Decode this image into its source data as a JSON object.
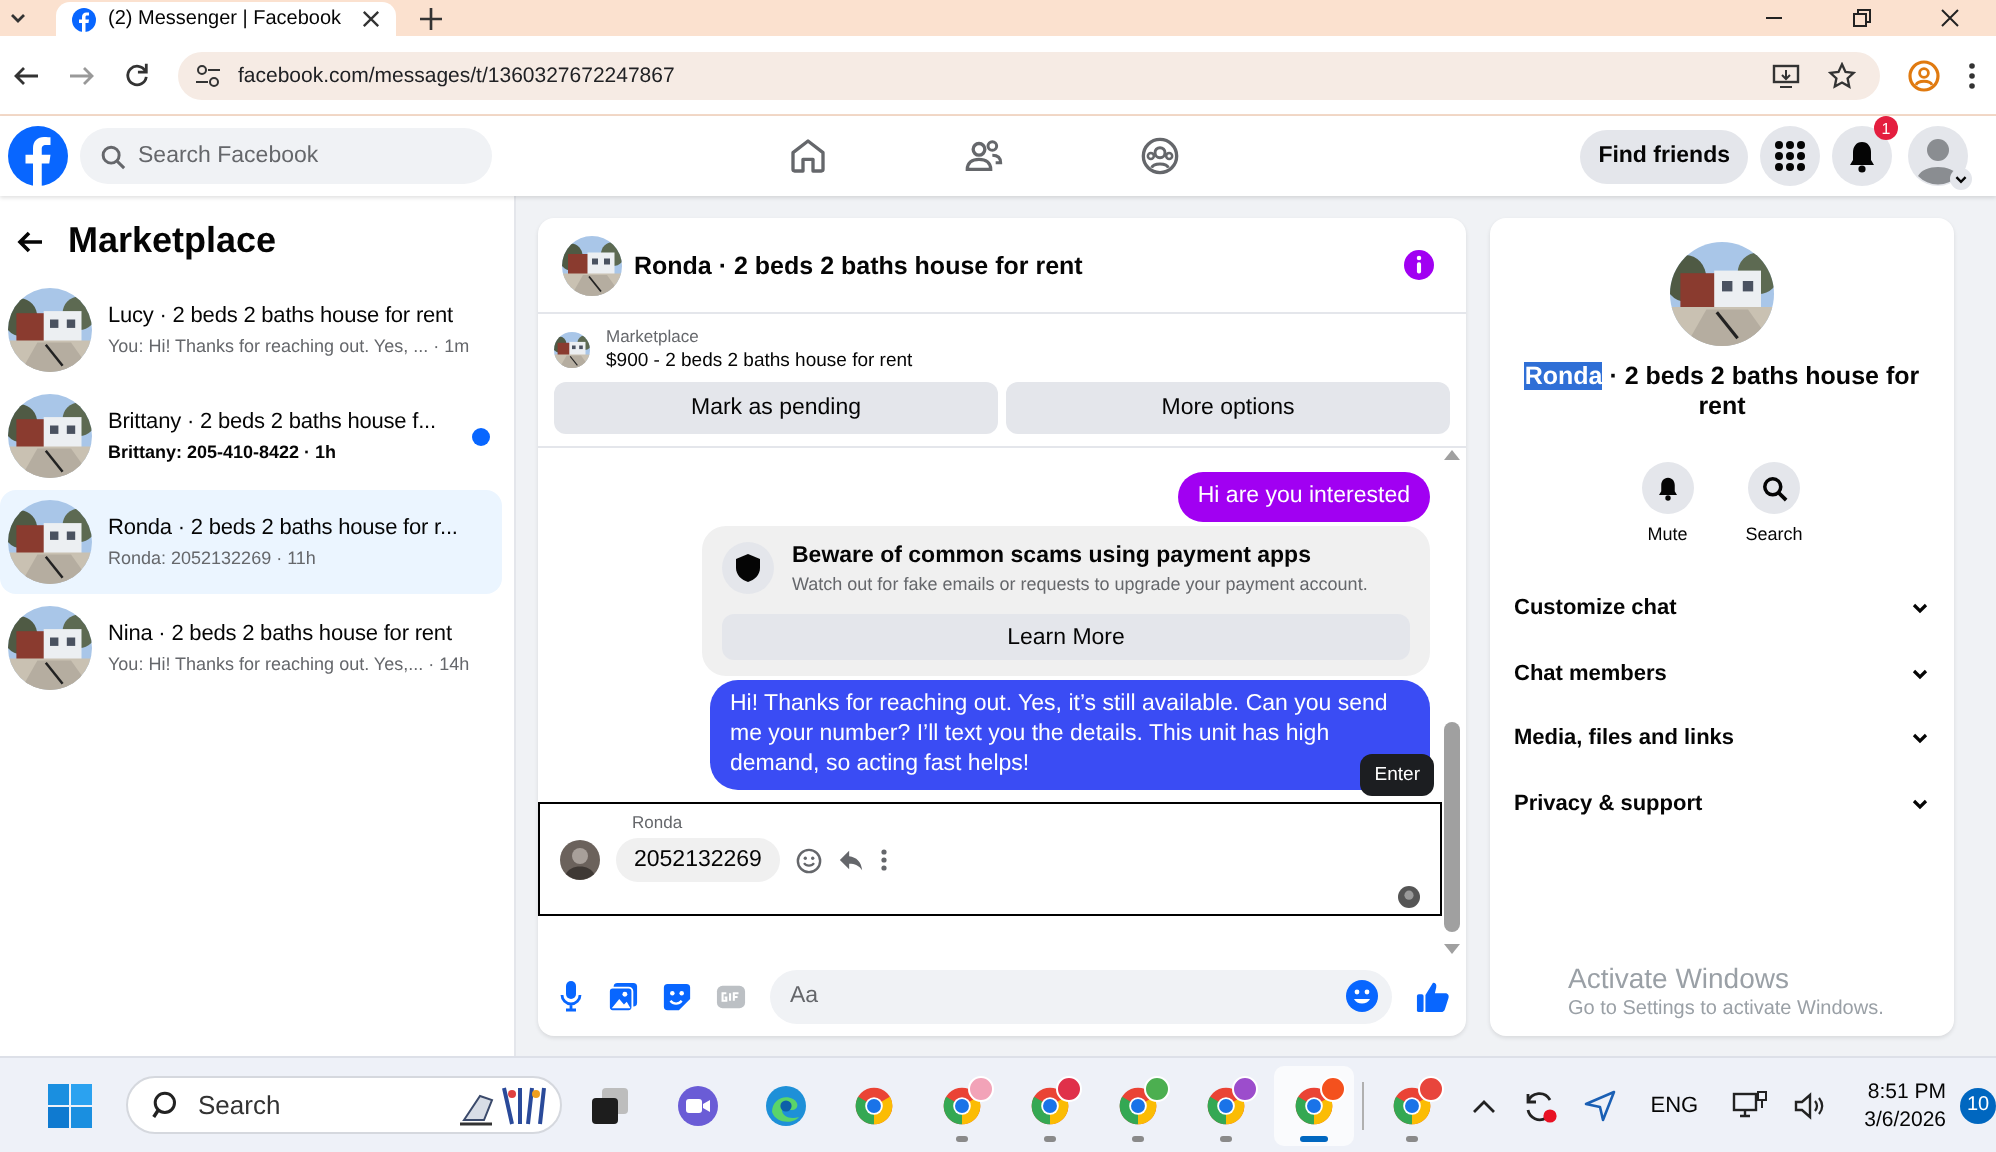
{
  "browser": {
    "tab": {
      "title": "(2) Messenger | Facebook"
    },
    "url": "facebook.com/messages/t/1360327672247867"
  },
  "header": {
    "search": {
      "placeholder": "Search Facebook"
    },
    "nav": [
      {
        "kind": "home"
      },
      {
        "kind": "friends"
      },
      {
        "kind": "groups"
      }
    ],
    "find_friends": "Find friends",
    "notifications_badge": "1"
  },
  "sidebar": {
    "title": "Marketplace",
    "items": [
      {
        "title": "Lucy · 2 beds 2 baths house for rent",
        "preview": "You: Hi! Thanks for reaching out. Yes, ... · 1m",
        "unread": false,
        "selected": false
      },
      {
        "title": "Brittany · 2 beds 2 baths house f...",
        "preview": "Brittany: 205-410-8422 · 1h",
        "unread": true,
        "selected": false
      },
      {
        "title": "Ronda · 2 beds 2 baths house for r...",
        "preview": "Ronda: 2052132269 · 11h",
        "unread": false,
        "selected": true
      },
      {
        "title": "Nina · 2 beds 2 baths house for rent",
        "preview": "You: Hi! Thanks for reaching out. Yes,... · 14h",
        "unread": false,
        "selected": false
      }
    ]
  },
  "chat": {
    "title": "Ronda · 2 beds 2 baths house for rent",
    "listing": {
      "label": "Marketplace",
      "title": "$900 - 2 beds 2 baths house for rent"
    },
    "actions": [
      "Mark as pending",
      "More options"
    ],
    "messages": [
      {
        "kind": "outgoing",
        "text": "Hi are you interested",
        "color": "#a100f2"
      },
      {
        "kind": "notice",
        "title": "Beware of common scams using payment apps",
        "text": "Watch out for fake emails or requests to upgrade your payment account.",
        "button": "Learn More"
      },
      {
        "kind": "outgoing",
        "text": "Hi! Thanks for reaching out. Yes, it’s still available. Can you send me your number? I’ll text you the details. This unit has high demand, so acting fast helps!",
        "color": "#3a4cf4",
        "tooltip": "Enter"
      },
      {
        "kind": "incoming",
        "sender": "Ronda",
        "text": "2052132269",
        "focused": true,
        "seen": true
      }
    ],
    "composer": {
      "placeholder": "Aa"
    }
  },
  "details": {
    "title_parts": [
      {
        "text": "Ronda",
        "selected": true
      },
      {
        "text": " · 2 beds 2 baths house for rent",
        "selected": false
      }
    ],
    "actions": [
      {
        "kind": "mute",
        "label": "Mute"
      },
      {
        "kind": "search",
        "label": "Search"
      }
    ],
    "sections": [
      {
        "label": "Customize chat",
        "expanded": false
      },
      {
        "label": "Chat members",
        "expanded": false
      },
      {
        "label": "Media, files and links",
        "expanded": false
      },
      {
        "label": "Privacy & support",
        "expanded": false
      }
    ]
  },
  "os_notice": {
    "title": "Activate Windows",
    "text": "Go to Settings to activate Windows."
  },
  "taskbar": {
    "search": {
      "placeholder": "Search"
    },
    "apps": [
      {
        "kind": "taskview",
        "running": false,
        "selected": false
      },
      {
        "kind": "meet",
        "running": false,
        "selected": false
      },
      {
        "kind": "edge",
        "running": false,
        "selected": false
      },
      {
        "kind": "chrome",
        "running": false,
        "selected": false
      },
      {
        "kind": "chrome",
        "color": "#f2a3b8",
        "running": true,
        "selected": false
      },
      {
        "kind": "chrome",
        "color": "#e0304a",
        "running": true,
        "selected": false
      },
      {
        "kind": "chrome",
        "color": "#4caf50",
        "running": true,
        "selected": false
      },
      {
        "kind": "chrome",
        "color": "#9c4dcc",
        "running": true,
        "selected": false
      },
      {
        "kind": "chrome",
        "color": "#f4511e",
        "running": true,
        "selected": true
      },
      {
        "kind": "chrome",
        "color": "#e8453c",
        "running": true,
        "selected": false
      }
    ],
    "language": "ENG",
    "time": "8:51 PM",
    "date": "3/6/2026",
    "notifications": "10"
  }
}
